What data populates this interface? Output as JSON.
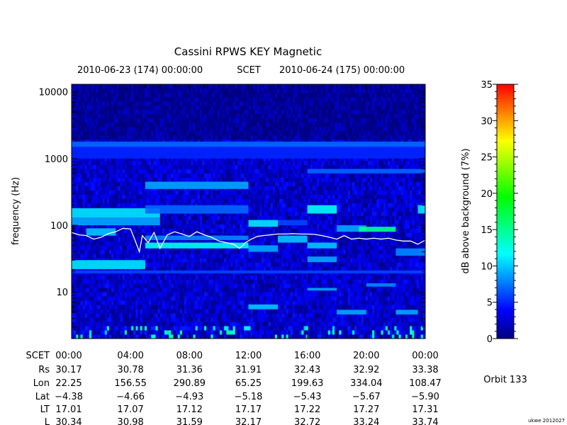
{
  "chart_data": {
    "type": "heatmap",
    "title": "Cassini RPWS KEY Magnetic",
    "time_header": {
      "start": "2010-06-23 (174) 00:00:00",
      "frame": "SCET",
      "end": "2010-06-24 (175) 00:00:00"
    },
    "ylabel": "frequency (Hz)",
    "y_scale": "log",
    "ylim": [
      2,
      13000
    ],
    "y_ticks": [
      10,
      100,
      1000,
      10000
    ],
    "y_tick_labels": [
      "10",
      "100",
      "1000",
      "10000"
    ],
    "xlim": [
      0,
      24
    ],
    "x_unit": "hours SCET",
    "colorbar": {
      "label": "dB above background (7%)",
      "range": [
        0,
        35
      ],
      "ticks": [
        0,
        5,
        10,
        15,
        20,
        25,
        30,
        35
      ],
      "colors": [
        "#000080",
        "#0000ff",
        "#0080ff",
        "#00ffff",
        "#00ff80",
        "#00ff00",
        "#80ff00",
        "#ffff00",
        "#ff8000",
        "#ff0000"
      ]
    },
    "ephemeris": {
      "row_labels": [
        "SCET",
        "Rs",
        "Lon",
        "Lat",
        "LT",
        "L"
      ],
      "columns": [
        [
          "00:00",
          "30.17",
          "22.25",
          "−4.38",
          "17.01",
          "30.34"
        ],
        [
          "04:00",
          "30.78",
          "156.55",
          "−4.66",
          "17.07",
          "30.98"
        ],
        [
          "08:00",
          "31.36",
          "290.89",
          "−4.93",
          "17.12",
          "31.59"
        ],
        [
          "12:00",
          "31.91",
          "65.25",
          "−5.18",
          "17.17",
          "32.17"
        ],
        [
          "16:00",
          "32.43",
          "199.63",
          "−5.43",
          "17.22",
          "32.72"
        ],
        [
          "20:00",
          "32.92",
          "334.04",
          "−5.67",
          "17.27",
          "33.24"
        ],
        [
          "00:00",
          "33.38",
          "108.47",
          "−5.90",
          "17.31",
          "33.74"
        ]
      ]
    },
    "overlay_line": {
      "color": "#ffffff",
      "points": [
        [
          0,
          78
        ],
        [
          0.5,
          72
        ],
        [
          1,
          70
        ],
        [
          1.5,
          62
        ],
        [
          2,
          66
        ],
        [
          2.5,
          75
        ],
        [
          3,
          80
        ],
        [
          3.5,
          90
        ],
        [
          4,
          88
        ],
        [
          4.3,
          60
        ],
        [
          4.6,
          40
        ],
        [
          4.8,
          70
        ],
        [
          5.2,
          55
        ],
        [
          5.6,
          78
        ],
        [
          6,
          45
        ],
        [
          6.5,
          72
        ],
        [
          7,
          80
        ],
        [
          7.5,
          74
        ],
        [
          8,
          68
        ],
        [
          8.5,
          80
        ],
        [
          9,
          72
        ],
        [
          9.5,
          66
        ],
        [
          10,
          58
        ],
        [
          10.5,
          55
        ],
        [
          11,
          52
        ],
        [
          11.4,
          45
        ],
        [
          11.8,
          55
        ],
        [
          12.2,
          62
        ],
        [
          12.6,
          68
        ],
        [
          13,
          70
        ],
        [
          13.5,
          72
        ],
        [
          14,
          74
        ],
        [
          14.5,
          74
        ],
        [
          15,
          75
        ],
        [
          15.5,
          74
        ],
        [
          16,
          74
        ],
        [
          16.5,
          73
        ],
        [
          17,
          70
        ],
        [
          17.5,
          66
        ],
        [
          18,
          62
        ],
        [
          18.5,
          70
        ],
        [
          19,
          62
        ],
        [
          19.5,
          64
        ],
        [
          20,
          62
        ],
        [
          20.5,
          64
        ],
        [
          21,
          62
        ],
        [
          21.5,
          64
        ],
        [
          22,
          60
        ],
        [
          22.5,
          58
        ],
        [
          23,
          58
        ],
        [
          23.5,
          52
        ],
        [
          24,
          60
        ]
      ]
    },
    "bands": [
      {
        "t0": 0,
        "t1": 24,
        "f0": 1000,
        "f1": 1700,
        "level": 5
      },
      {
        "t0": 0,
        "t1": 24,
        "f0": 1500,
        "f1": 1800,
        "level": 7
      },
      {
        "t0": 0,
        "t1": 6,
        "f0": 130,
        "f1": 180,
        "level": 11
      },
      {
        "t0": 0,
        "t1": 6,
        "f0": 100,
        "f1": 130,
        "level": 9
      },
      {
        "t0": 1,
        "t1": 3,
        "f0": 70,
        "f1": 90,
        "level": 10
      },
      {
        "t0": 0,
        "t1": 5,
        "f0": 22,
        "f1": 30,
        "level": 11
      },
      {
        "t0": 5,
        "t1": 12,
        "f0": 350,
        "f1": 450,
        "level": 9
      },
      {
        "t0": 5,
        "t1": 12,
        "f0": 150,
        "f1": 200,
        "level": 7
      },
      {
        "t0": 5,
        "t1": 12,
        "f0": 45,
        "f1": 55,
        "level": 12
      },
      {
        "t0": 5,
        "t1": 12,
        "f0": 60,
        "f1": 70,
        "level": 8
      },
      {
        "t0": 12,
        "t1": 14,
        "f0": 95,
        "f1": 120,
        "level": 11
      },
      {
        "t0": 12,
        "t1": 14,
        "f0": 40,
        "f1": 50,
        "level": 9
      },
      {
        "t0": 12,
        "t1": 14,
        "f0": 5.5,
        "f1": 6.5,
        "level": 10
      },
      {
        "t0": 14,
        "t1": 16,
        "f0": 55,
        "f1": 70,
        "level": 10
      },
      {
        "t0": 14,
        "t1": 16,
        "f0": 100,
        "f1": 120,
        "level": 6
      },
      {
        "t0": 16,
        "t1": 18,
        "f0": 150,
        "f1": 200,
        "level": 12
      },
      {
        "t0": 16,
        "t1": 18,
        "f0": 45,
        "f1": 55,
        "level": 10
      },
      {
        "t0": 16,
        "t1": 18,
        "f0": 28,
        "f1": 34,
        "level": 9
      },
      {
        "t0": 16,
        "t1": 18,
        "f0": 10.5,
        "f1": 11.5,
        "level": 9
      },
      {
        "t0": 16,
        "t1": 24,
        "f0": 600,
        "f1": 700,
        "level": 7
      },
      {
        "t0": 18,
        "t1": 20,
        "f0": 80,
        "f1": 100,
        "level": 9
      },
      {
        "t0": 18,
        "t1": 20,
        "f0": 4.6,
        "f1": 5.4,
        "level": 9
      },
      {
        "t0": 19.5,
        "t1": 22,
        "f0": 80,
        "f1": 95,
        "level": 15
      },
      {
        "t0": 20,
        "t1": 22,
        "f0": 12,
        "f1": 13.5,
        "level": 8
      },
      {
        "t0": 22,
        "t1": 23.5,
        "f0": 4.6,
        "f1": 5.4,
        "level": 9
      },
      {
        "t0": 22,
        "t1": 24,
        "f0": 35,
        "f1": 45,
        "level": 8
      },
      {
        "t0": 23.5,
        "t1": 24,
        "f0": 150,
        "f1": 200,
        "level": 11
      },
      {
        "t0": 0,
        "t1": 24,
        "f0": 19,
        "f1": 21,
        "level": 6
      }
    ]
  },
  "orbit_label": "Orbit 133",
  "credit": "ukwe 2012027"
}
